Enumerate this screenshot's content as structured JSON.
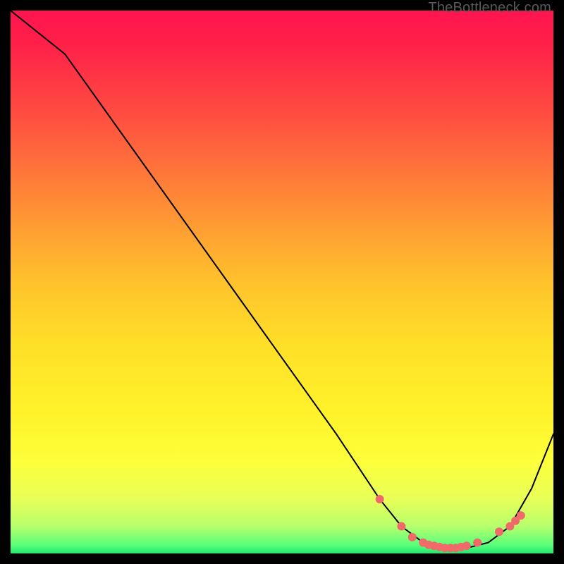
{
  "watermark": "TheBottleneck.com",
  "chart_data": {
    "type": "line",
    "title": "",
    "xlabel": "",
    "ylabel": "",
    "xlim": [
      0,
      100
    ],
    "ylim": [
      0,
      100
    ],
    "series": [
      {
        "name": "curve",
        "x": [
          0,
          10,
          20,
          30,
          40,
          50,
          60,
          68,
          72,
          76,
          80,
          84,
          88,
          92,
          96,
          100
        ],
        "y": [
          100,
          92,
          78,
          64,
          50,
          36,
          22,
          10,
          5,
          2,
          1,
          1,
          2,
          5,
          12,
          22
        ]
      }
    ],
    "markers": {
      "name": "samples",
      "x": [
        68,
        72,
        74,
        76,
        77,
        78,
        79,
        80,
        81,
        82,
        83,
        84,
        86,
        90,
        92,
        93,
        94
      ],
      "y": [
        10,
        5,
        3,
        2,
        1.6,
        1.4,
        1.2,
        1,
        1,
        1,
        1.2,
        1.4,
        2,
        4,
        5,
        6,
        7
      ],
      "color": "#f06a6a",
      "radius": 6
    },
    "gradient_stops": [
      {
        "offset": 0.0,
        "color": "#ff1450"
      },
      {
        "offset": 0.06,
        "color": "#ff2049"
      },
      {
        "offset": 0.2,
        "color": "#ff5040"
      },
      {
        "offset": 0.35,
        "color": "#ff8a36"
      },
      {
        "offset": 0.5,
        "color": "#ffc22c"
      },
      {
        "offset": 0.62,
        "color": "#ffe028"
      },
      {
        "offset": 0.74,
        "color": "#fff22a"
      },
      {
        "offset": 0.83,
        "color": "#fcff3a"
      },
      {
        "offset": 0.9,
        "color": "#e8ff58"
      },
      {
        "offset": 0.95,
        "color": "#b6ff6c"
      },
      {
        "offset": 0.985,
        "color": "#58ff7a"
      },
      {
        "offset": 1.0,
        "color": "#20e870"
      }
    ]
  }
}
